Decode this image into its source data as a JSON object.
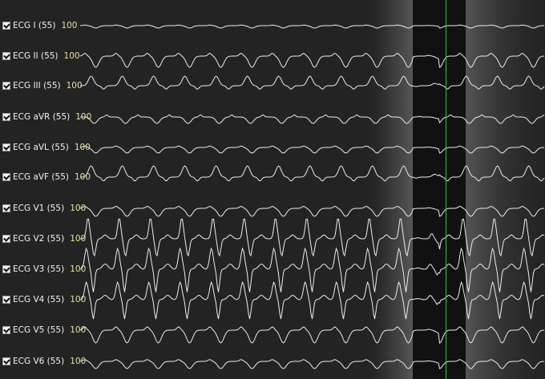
{
  "cursor_color": "#35c43a",
  "trace_color": "#ececec",
  "scale_color": "#e9e0a0",
  "leads": [
    {
      "label": "ECG I (55)",
      "scale": "100",
      "checked": true
    },
    {
      "label": "ECG II (55)",
      "scale": "100",
      "checked": true
    },
    {
      "label": "ECG III (55)",
      "scale": "100",
      "checked": true
    },
    {
      "label": "ECG aVR (55)",
      "scale": "100",
      "checked": true
    },
    {
      "label": "ECG aVL (55)",
      "scale": "100",
      "checked": true
    },
    {
      "label": "ECG aVF (55)",
      "scale": "100",
      "checked": true
    },
    {
      "label": "ECG V1 (55)",
      "scale": "100",
      "checked": true
    },
    {
      "label": "ECG V2 (55)",
      "scale": "100",
      "checked": true
    },
    {
      "label": "ECG V3 (55)",
      "scale": "100",
      "checked": true
    },
    {
      "label": "ECG V4 (55)",
      "scale": "100",
      "checked": true
    },
    {
      "label": "ECG V5 (55)",
      "scale": "100",
      "checked": true
    },
    {
      "label": "ECG V6 (55)",
      "scale": "100",
      "checked": true
    }
  ]
}
